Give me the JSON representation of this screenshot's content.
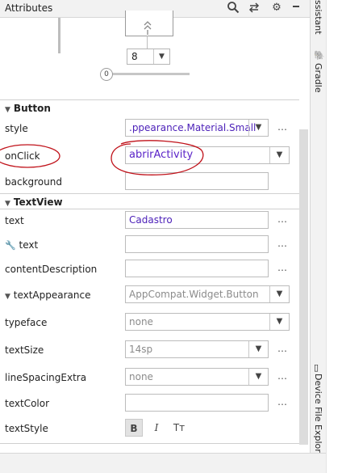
{
  "header": {
    "title": "Attributes",
    "icons": [
      "search-icon",
      "swap-icon",
      "gear-icon",
      "minimize-icon"
    ]
  },
  "right_strip": {
    "tabs": [
      "ssistant",
      "Gradle",
      "Device File Explorer"
    ]
  },
  "top_widget": {
    "margin_value": "8",
    "slider_value": "0"
  },
  "sections": {
    "button": {
      "title": "Button"
    },
    "textview": {
      "title": "TextView"
    }
  },
  "attributes": {
    "style": {
      "label": "style",
      "value": ".ppearance.Material.Small"
    },
    "onClick": {
      "label": "onClick",
      "value": "abrirActivity"
    },
    "background": {
      "label": "background",
      "value": ""
    },
    "text": {
      "label": "text",
      "value": "Cadastro"
    },
    "tools_text": {
      "label": "text",
      "value": ""
    },
    "contentDescription": {
      "label": "contentDescription",
      "value": ""
    },
    "textAppearance": {
      "label": "textAppearance",
      "value": "AppCompat.Widget.Button"
    },
    "typeface": {
      "label": "typeface",
      "value": "none"
    },
    "textSize": {
      "label": "textSize",
      "value": "14sp"
    },
    "lineSpacingExtra": {
      "label": "lineSpacingExtra",
      "value": "none"
    },
    "textColor": {
      "label": "textColor",
      "value": ""
    },
    "textStyle": {
      "label": "textStyle",
      "bold": "B",
      "italic": "I",
      "caps": "Tт"
    }
  },
  "more_label": "…",
  "colors": {
    "annotation_red": "#c0121a",
    "value_purple": "#5a23c8"
  }
}
